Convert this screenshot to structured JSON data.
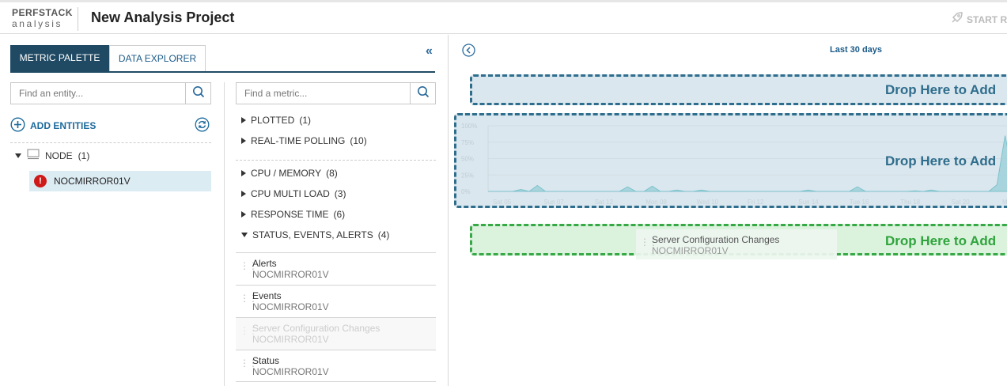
{
  "header": {
    "logo_top": "PERFSTACK",
    "logo_bottom": "analysis",
    "title": "New Analysis Project",
    "start_label": "START R"
  },
  "tabs": [
    {
      "label": "METRIC PALETTE",
      "active": true
    },
    {
      "label": "DATA EXPLORER",
      "active": false
    }
  ],
  "entity_search": {
    "placeholder": "Find an entity..."
  },
  "metric_search": {
    "placeholder": "Find a metric..."
  },
  "add_entities_label": "ADD ENTITIES",
  "node_group": {
    "label": "NODE",
    "count": "(1)"
  },
  "entities": [
    {
      "name": "NOCMIRROR01V",
      "status": "critical"
    }
  ],
  "categories": [
    {
      "label": "PLOTTED",
      "count": "(1)",
      "expanded": false
    },
    {
      "label": "REAL-TIME POLLING",
      "count": "(10)",
      "expanded": false
    },
    {
      "label": "CPU / MEMORY",
      "count": "(8)",
      "expanded": false
    },
    {
      "label": "CPU MULTI LOAD",
      "count": "(3)",
      "expanded": false
    },
    {
      "label": "RESPONSE TIME",
      "count": "(6)",
      "expanded": false
    },
    {
      "label": "STATUS, EVENTS, ALERTS",
      "count": "(4)",
      "expanded": true
    }
  ],
  "metrics": [
    {
      "name": "Alerts",
      "entity": "NOCMIRROR01V",
      "dragging": false
    },
    {
      "name": "Events",
      "entity": "NOCMIRROR01V",
      "dragging": false
    },
    {
      "name": "Server Configuration Changes",
      "entity": "NOCMIRROR01V",
      "dragging": true
    },
    {
      "name": "Status",
      "entity": "NOCMIRROR01V",
      "dragging": false
    }
  ],
  "time_range": "Last 30 days",
  "drop_zones": [
    {
      "label": "Drop Here to Add"
    },
    {
      "label": "Drop Here to Add"
    },
    {
      "label": "Drop Here to Add"
    }
  ],
  "chart_data": {
    "type": "area",
    "y_tick_labels": [
      "100%",
      "75%",
      "50%",
      "25%",
      "0%"
    ],
    "ylim": [
      0,
      100
    ],
    "x_tick_labels": [
      "Sat 05",
      "Sun 07",
      "Sat 12",
      "Mon 08",
      "Wed 10",
      "Fri 12",
      "Sun 14",
      "Tue 16",
      "Thu 18",
      "Sat 20",
      "Mon 22"
    ],
    "values": [
      0,
      0,
      0,
      0,
      3,
      0,
      9,
      0,
      0,
      0,
      0,
      0,
      0,
      0,
      0,
      0,
      0,
      7,
      0,
      0,
      8,
      0,
      0,
      2,
      0,
      0,
      2,
      0,
      0,
      0,
      0,
      0,
      0,
      0,
      0,
      0,
      0,
      0,
      0,
      2,
      0,
      0,
      0,
      0,
      0,
      7,
      0,
      0,
      0,
      0,
      0,
      0,
      1,
      0,
      2,
      0,
      0,
      0,
      0,
      0,
      0,
      0,
      10,
      85,
      20
    ],
    "colors": {
      "fill": "#9fd1d9",
      "line": "#7cc2cd"
    }
  },
  "drag_preview": {
    "name": "Server Configuration Changes",
    "entity": "NOCMIRROR01V"
  }
}
